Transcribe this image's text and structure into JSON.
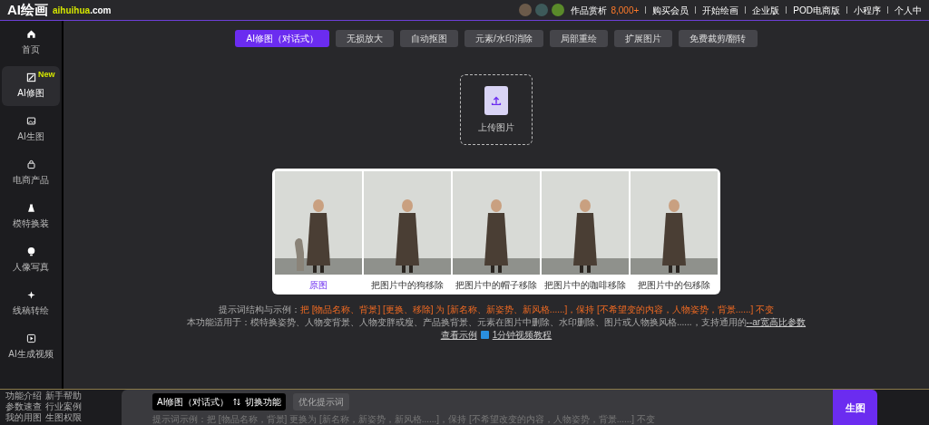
{
  "header": {
    "logo": "AI绘画",
    "domain_main": "aihuihua",
    "domain_suffix": ".com",
    "gallery_label": "作品赏析",
    "gallery_count": "8,000+",
    "links": [
      "购买会员",
      "开始绘画",
      "企业版",
      "POD电商版",
      "小程序",
      "个人中"
    ]
  },
  "tabs": [
    {
      "label": "AI修图（对话式）",
      "selected": true
    },
    {
      "label": "无损放大",
      "selected": false
    },
    {
      "label": "自动抠图",
      "selected": false
    },
    {
      "label": "元素/水印消除",
      "selected": false
    },
    {
      "label": "局部重绘",
      "selected": false
    },
    {
      "label": "扩展图片",
      "selected": false
    },
    {
      "label": "免费裁剪/翻转",
      "selected": false
    }
  ],
  "sidebar": {
    "items": [
      {
        "label": "首页",
        "selected": false
      },
      {
        "label": "AI修图",
        "selected": true,
        "badge": "New"
      },
      {
        "label": "AI生图",
        "selected": false
      },
      {
        "label": "电商产品",
        "selected": false
      },
      {
        "label": "模特换装",
        "selected": false
      },
      {
        "label": "人像写真",
        "selected": false
      },
      {
        "label": "线稿转绘",
        "selected": false
      },
      {
        "label": "AI生成视频",
        "selected": false
      }
    ],
    "footer_links": [
      [
        "功能介绍",
        "新手帮助"
      ],
      [
        "参数速查",
        "行业案例"
      ],
      [
        "我的用图",
        "生图权限"
      ]
    ]
  },
  "upload": {
    "label": "上传图片"
  },
  "examples": [
    {
      "caption": "原图",
      "selected": true,
      "dog": true
    },
    {
      "caption": "把图片中的狗移除",
      "selected": false,
      "dog": false
    },
    {
      "caption": "把图片中的帽子移除",
      "selected": false,
      "dog": false
    },
    {
      "caption": "把图片中的咖啡移除",
      "selected": false,
      "dog": false
    },
    {
      "caption": "把图片中的包移除",
      "selected": false,
      "dog": false
    }
  ],
  "tips": {
    "structure_label": "提示词结构与示例：",
    "structure": "把 [物品名称、背景] [更换、移除] 为 [新名称、新姿势、新风格......]，保持 [不希望变的内容，人物姿势，背景......] 不变",
    "usage": "本功能适用于：模特换姿势、人物变背景、人物变胖或瘦、产品换背景、元素在图片中删除、水印删除、图片或人物换风格......，支持通用的",
    "usage_link": "--ar宽高比参数",
    "example_link": "查看示例",
    "video_link": "1分钟视频教程"
  },
  "composer": {
    "mode": "AI修图（对话式）",
    "switch": "切换功能",
    "optimize": "优化提示词",
    "placeholder": "提示词示例：把 [物品名称，背景] 更换为 [新名称，新姿势，新风格......]，保持 [不希望改变的内容，人物姿势，背景......] 不变",
    "generate": "生图"
  }
}
